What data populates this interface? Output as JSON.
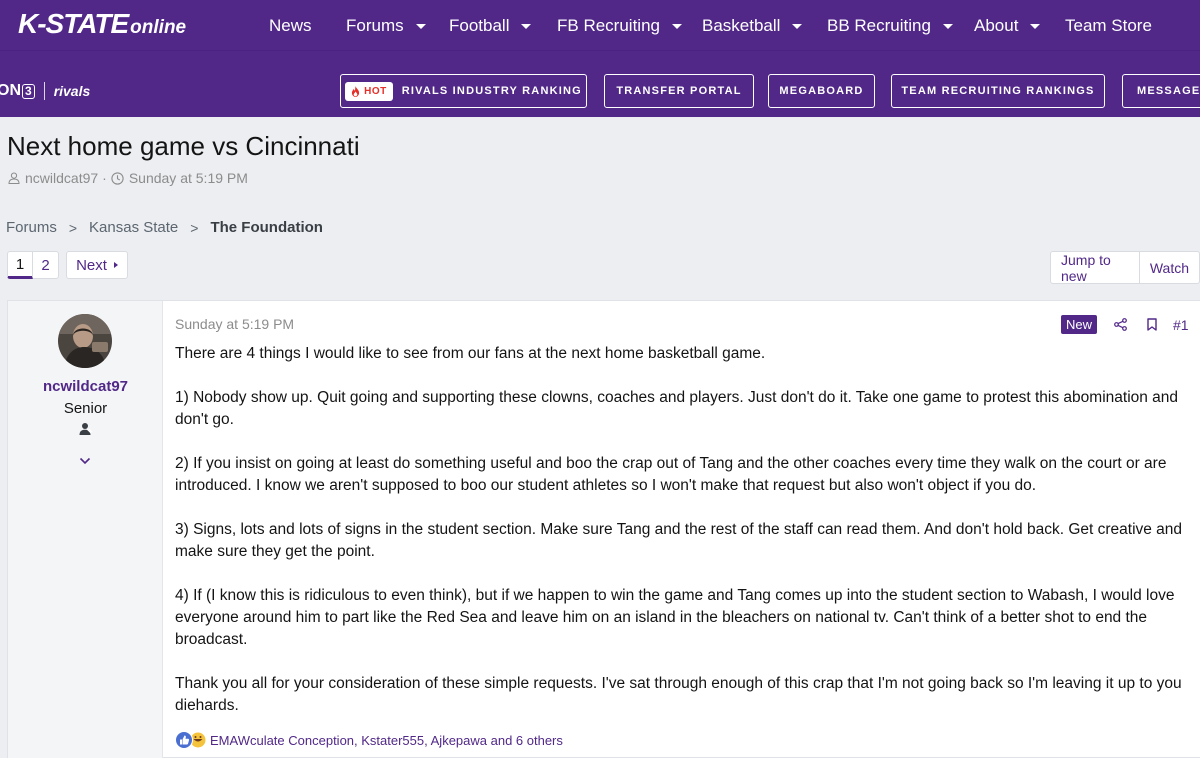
{
  "site": {
    "logo_main": "K-STATE",
    "logo_sub": "online",
    "nav": [
      {
        "label": "News",
        "dropdown": false
      },
      {
        "label": "Forums",
        "dropdown": true
      },
      {
        "label": "Football",
        "dropdown": true
      },
      {
        "label": "FB Recruiting",
        "dropdown": true
      },
      {
        "label": "Basketball",
        "dropdown": true
      },
      {
        "label": "BB Recruiting",
        "dropdown": true
      },
      {
        "label": "About",
        "dropdown": true
      },
      {
        "label": "Team Store",
        "dropdown": false
      }
    ]
  },
  "subnav": {
    "brand_on": "ON",
    "brand_three": "3",
    "brand_rivals": "rivals",
    "hot_label": "HOT",
    "links": [
      "RIVALS INDUSTRY RANKING",
      "TRANSFER PORTAL",
      "MEGABOARD",
      "TEAM RECRUITING RANKINGS",
      "MESSAGE"
    ]
  },
  "thread": {
    "title": "Next home game vs Cincinnati",
    "author": "ncwildcat97",
    "date": "Sunday at 5:19 PM",
    "breadcrumb": [
      "Forums",
      "Kansas State",
      "The Foundation"
    ],
    "pages": [
      "1",
      "2"
    ],
    "next_label": "Next",
    "jump_label": "Jump to new",
    "watch_label": "Watch"
  },
  "post": {
    "username": "ncwildcat97",
    "user_title": "Senior",
    "date": "Sunday at 5:19 PM",
    "new_label": "New",
    "number": "#1",
    "paragraphs": [
      "There are 4 things I would like to see from our fans at the next home basketball game.",
      "1) Nobody show up. Quit going and supporting these clowns, coaches and players. Just don't do it. Take one game to protest this abomination and don't go.",
      "2) If you insist on going at least do something useful and boo the crap out of Tang and the other coaches every time they walk on the court or are introduced. I know we aren't supposed to boo our student athletes so I won't make that request but also won't object if you do.",
      "3) Signs, lots and lots of signs in the student section. Make sure Tang and the rest of the staff can read them. And don't hold back. Get creative and make sure they get the point.",
      "4) If (I know this is ridiculous to even think), but if we happen to win the game and Tang comes up into the student section to Wabash, I would love everyone around him to part like the Red Sea and leave him on an island in the bleachers on national tv. Can't think of a better shot to end the broadcast.",
      "Thank you all for your consideration of these simple requests. I've sat through enough of this crap that I'm not going back so I'm leaving it up to you diehards."
    ],
    "reactions": "EMAWculate Conception, Kstater555, Ajkepawa and 6 others"
  },
  "colors": {
    "brand_purple": "#512888",
    "hot_red": "#e5302a",
    "page_bg": "#eceef1"
  },
  "icons": [
    "user-icon",
    "clock-icon",
    "share-icon",
    "bookmark-icon",
    "like-icon",
    "laugh-icon",
    "chevron-down-icon",
    "flame-icon"
  ]
}
